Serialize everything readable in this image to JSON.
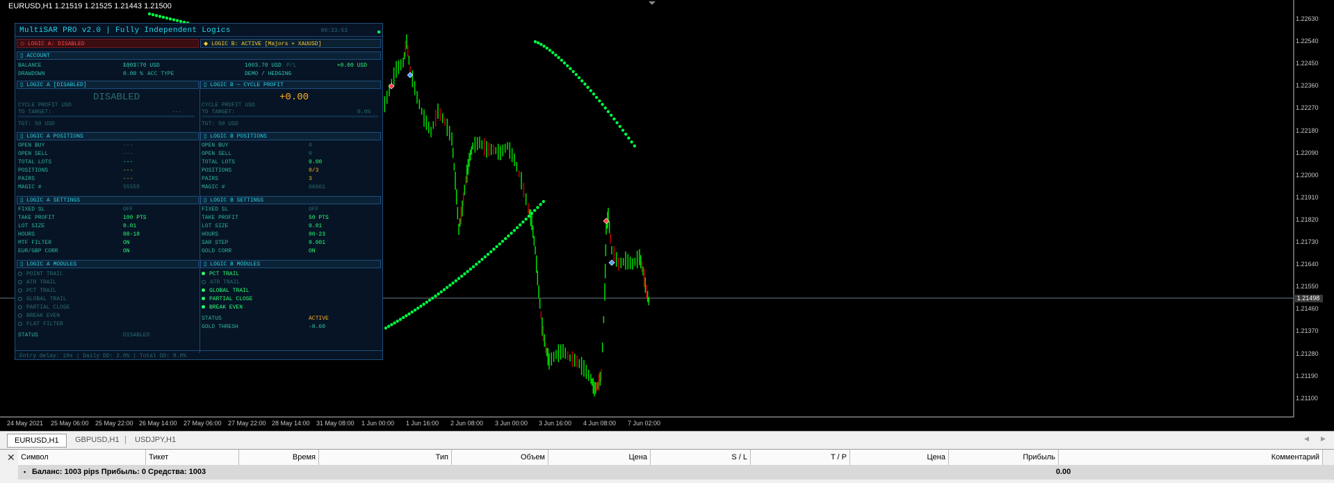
{
  "chart": {
    "symbol_header": "EURUSD,H1  1.21519 1.21525 1.21443 1.21500",
    "price_labels": [
      "1.22630",
      "1.22540",
      "1.22450",
      "1.22360",
      "1.22270",
      "1.22180",
      "1.22090",
      "1.22000",
      "1.21910",
      "1.21820",
      "1.21730",
      "1.21640",
      "1.21550",
      "1.21460",
      "1.21370",
      "1.21280",
      "1.21190",
      "1.21100"
    ],
    "current_price": "1.21498",
    "time_labels": [
      "24 May 2021",
      "25 May 06:00",
      "25 May 22:00",
      "26 May 14:00",
      "27 May 06:00",
      "27 May 22:00",
      "28 May 14:00",
      "31 May 08:00",
      "1 Jun 00:00",
      "1 Jun 16:00",
      "2 Jun 08:00",
      "3 Jun 00:00",
      "3 Jun 16:00",
      "4 Jun 08:00",
      "7 Jun 02:00"
    ],
    "colors": {
      "candle": "#00e000",
      "sar": "#00ff44",
      "background": "#000000"
    }
  },
  "panel": {
    "title": "MultiSAR PRO v2.0  |  Fully Independent Logics",
    "time": "09:23:53",
    "logic_a_status": "◇ LOGIC A: DISABLED",
    "logic_b_status": "◆ LOGIC B: ACTIVE  [Majors + XAUUSD]",
    "account": {
      "header": "▯ ACCOUNT",
      "balance_label": "BALANCE",
      "balance_val": "1003.70 USD",
      "equity_label": "EQUITY",
      "equity_val": "1003.70 USD",
      "pl_label": "P/L",
      "pl_val": "+0.00 USD",
      "drawdown_label": "DRAWDOWN",
      "drawdown_val": "0.00 %",
      "acc_type_label": "ACC TYPE",
      "acc_type_val": "DEMO / HEDGING"
    },
    "logic_a": {
      "header": "▯ LOGIC A [DISABLED]",
      "big": "DISABLED",
      "cycle_label": "CYCLE PROFIT  USD",
      "target_label": "TO TARGET:",
      "target_val": "---",
      "tgt": "TGT: 50 USD",
      "positions_header": "▯ LOGIC A POSITIONS",
      "positions": [
        {
          "k": "OPEN BUY",
          "v": "---"
        },
        {
          "k": "OPEN SELL",
          "v": "---"
        },
        {
          "k": "TOTAL LOTS",
          "v": "---"
        },
        {
          "k": "POSITIONS",
          "v": "---"
        },
        {
          "k": "PAIRS",
          "v": "---"
        },
        {
          "k": "MAGIC #",
          "v": "55555"
        }
      ],
      "settings_header": "▯ LOGIC A SETTINGS",
      "settings": [
        {
          "k": "FIXED SL",
          "v": "OFF"
        },
        {
          "k": "TAKE PROFIT",
          "v": "100 PTS"
        },
        {
          "k": "LOT SIZE",
          "v": "0.01"
        },
        {
          "k": "HOURS",
          "v": "08-18"
        },
        {
          "k": "MTF FILTER",
          "v": "ON"
        },
        {
          "k": "EUR/GBP CORR",
          "v": "ON"
        }
      ],
      "modules_header": "▯ LOGIC A MODULES",
      "modules": [
        "POINT TRAIL",
        "ATR TRAIL",
        "PCT TRAIL",
        "GLOBAL TRAIL",
        "PARTIAL CLOSE",
        "BREAK EVEN",
        "FLAT FILTER"
      ],
      "status_label": "STATUS",
      "status_val": "DISABLED"
    },
    "logic_b": {
      "header": "▯ LOGIC B — CYCLE PROFIT",
      "big": "+0.00",
      "cycle_label": "CYCLE PROFIT  USD",
      "target_label": "TO TARGET:",
      "target_val": "0.0%",
      "tgt": "TGT: 50 USD",
      "positions_header": "▯ LOGIC B POSITIONS",
      "positions": [
        {
          "k": "OPEN BUY",
          "v": "0"
        },
        {
          "k": "OPEN SELL",
          "v": "0"
        },
        {
          "k": "TOTAL LOTS",
          "v": "0.00"
        },
        {
          "k": "POSITIONS",
          "v": "0/3"
        },
        {
          "k": "PAIRS",
          "v": "3"
        },
        {
          "k": "MAGIC #",
          "v": "66661"
        }
      ],
      "settings_header": "▯ LOGIC B SETTINGS",
      "settings": [
        {
          "k": "FIXED SL",
          "v": "OFF"
        },
        {
          "k": "TAKE PROFIT",
          "v": "50 PTS"
        },
        {
          "k": "LOT SIZE",
          "v": "0.01"
        },
        {
          "k": "HOURS",
          "v": "00-23"
        },
        {
          "k": "SAR STEP",
          "v": "0.001"
        },
        {
          "k": "GOLD CORR",
          "v": "ON"
        }
      ],
      "modules_header": "▯ LOGIC B MODULES",
      "modules_on": [
        "PCT TRAIL"
      ],
      "modules_off": [
        "ATR TRAIL"
      ],
      "modules_on2": [
        "GLOBAL TRAIL",
        "PARTIAL CLOSE",
        "BREAK EVEN"
      ],
      "status_label": "STATUS",
      "status_val": "ACTIVE",
      "gold_label": "GOLD THRESH",
      "gold_val": "-0.60"
    },
    "footer": "Entry delay: 10s | Daily DD: 2.0% | Total DD: 8.0%"
  },
  "tabs": [
    "EURUSD,H1",
    "GBPUSD,H1",
    "USDJPY,H1"
  ],
  "terminal": {
    "columns": [
      "Символ",
      "Тикет",
      "Время",
      "Тип",
      "Объем",
      "Цена",
      "S / L",
      "T / P",
      "Цена",
      "Прибыль",
      "Комментарий"
    ],
    "summary": "Баланс: 1003 pips   Прибыль: 0   Средства: 1003",
    "profit": "0.00"
  }
}
